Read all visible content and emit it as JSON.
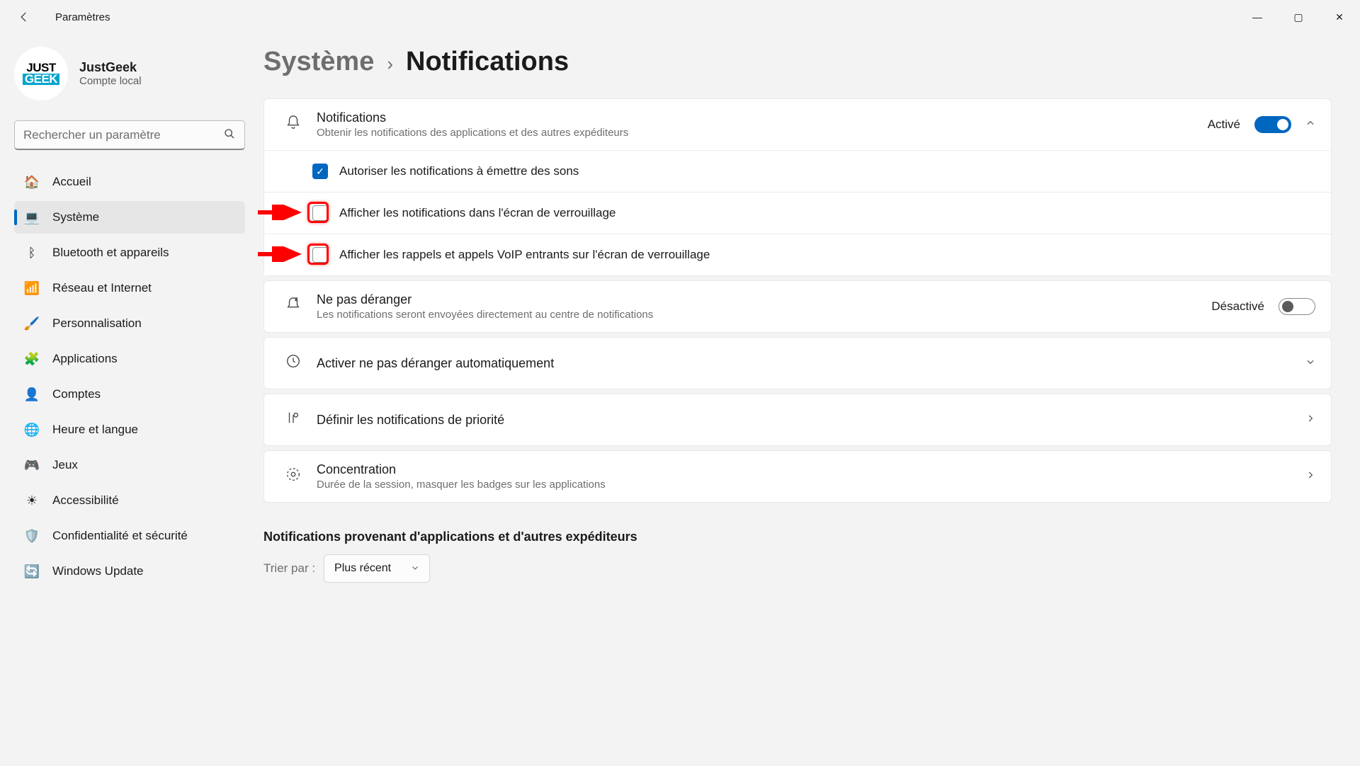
{
  "app_title": "Paramètres",
  "window_controls": {
    "min": "—",
    "max": "▢",
    "close": "✕"
  },
  "profile": {
    "name": "JustGeek",
    "sub": "Compte local",
    "avatar_line1": "JUST",
    "avatar_line2": "GEEK"
  },
  "search": {
    "placeholder": "Rechercher un paramètre"
  },
  "sidebar": {
    "items": [
      {
        "label": "Accueil",
        "icon": "🏠",
        "name": "sidebar-item-home"
      },
      {
        "label": "Système",
        "icon": "💻",
        "name": "sidebar-item-system",
        "active": true
      },
      {
        "label": "Bluetooth et appareils",
        "icon": "ᛒ",
        "name": "sidebar-item-bluetooth"
      },
      {
        "label": "Réseau et Internet",
        "icon": "📶",
        "name": "sidebar-item-network"
      },
      {
        "label": "Personnalisation",
        "icon": "🖌️",
        "name": "sidebar-item-personalization"
      },
      {
        "label": "Applications",
        "icon": "🧩",
        "name": "sidebar-item-apps"
      },
      {
        "label": "Comptes",
        "icon": "👤",
        "name": "sidebar-item-accounts"
      },
      {
        "label": "Heure et langue",
        "icon": "🌐",
        "name": "sidebar-item-time-language"
      },
      {
        "label": "Jeux",
        "icon": "🎮",
        "name": "sidebar-item-gaming"
      },
      {
        "label": "Accessibilité",
        "icon": "☀",
        "name": "sidebar-item-accessibility"
      },
      {
        "label": "Confidentialité et sécurité",
        "icon": "🛡️",
        "name": "sidebar-item-privacy"
      },
      {
        "label": "Windows Update",
        "icon": "🔄",
        "name": "sidebar-item-update"
      }
    ]
  },
  "breadcrumb": {
    "parent": "Système",
    "current": "Notifications"
  },
  "notifications_card": {
    "title": "Notifications",
    "sub": "Obtenir les notifications des applications et des autres expéditeurs",
    "state": "Activé",
    "toggled": true
  },
  "checks": [
    {
      "label": "Autoriser les notifications à émettre des sons",
      "checked": true,
      "highlight": false
    },
    {
      "label": "Afficher les notifications dans l'écran de verrouillage",
      "checked": false,
      "highlight": true
    },
    {
      "label": "Afficher les rappels et appels VoIP entrants sur l'écran de verrouillage",
      "checked": false,
      "highlight": true
    }
  ],
  "dnd": {
    "title": "Ne pas déranger",
    "sub": "Les notifications seront envoyées directement au centre de notifications",
    "state": "Désactivé",
    "toggled": false
  },
  "auto_dnd": {
    "title": "Activer ne pas déranger automatiquement"
  },
  "priority": {
    "title": "Définir les notifications de priorité"
  },
  "focus": {
    "title": "Concentration",
    "sub": "Durée de la session, masquer les badges sur les applications"
  },
  "apps_section": {
    "heading": "Notifications provenant d'applications et d'autres expéditeurs",
    "sort_label": "Trier par :",
    "sort_value": "Plus récent"
  }
}
